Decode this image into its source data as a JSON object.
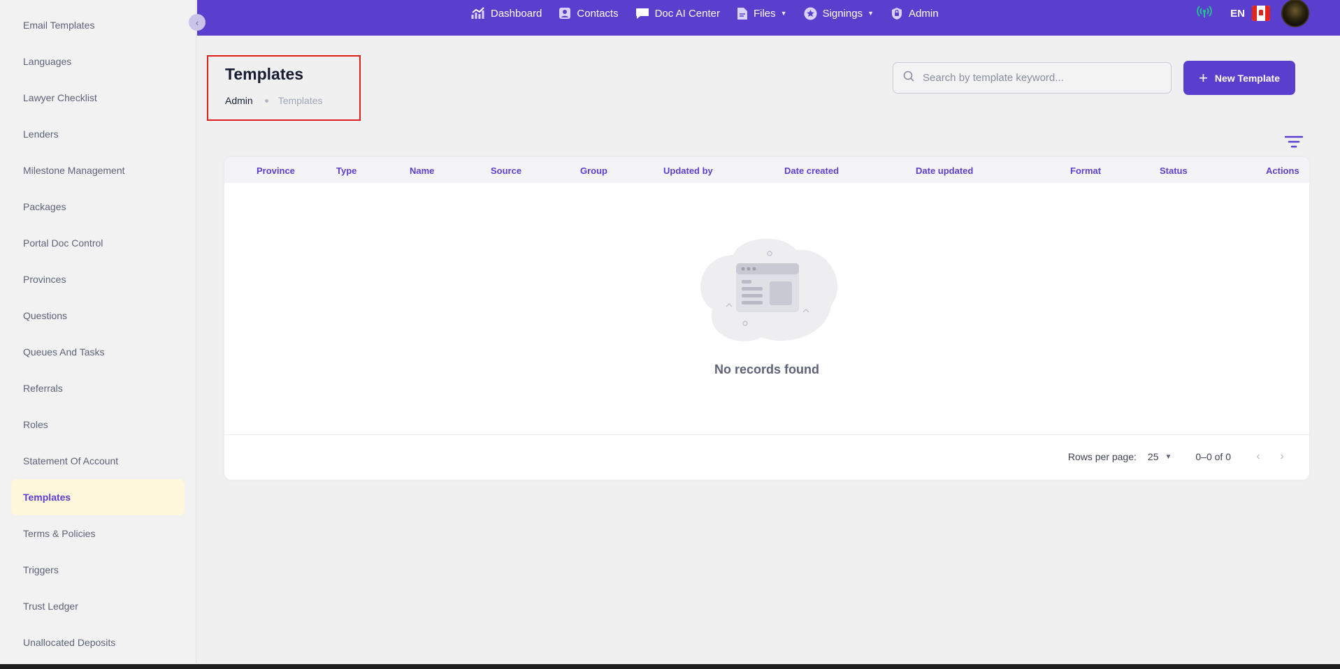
{
  "sidebar": {
    "items": [
      {
        "label": "Email Templates"
      },
      {
        "label": "Languages"
      },
      {
        "label": "Lawyer Checklist"
      },
      {
        "label": "Lenders"
      },
      {
        "label": "Milestone Management"
      },
      {
        "label": "Packages"
      },
      {
        "label": "Portal Doc Control"
      },
      {
        "label": "Provinces"
      },
      {
        "label": "Questions"
      },
      {
        "label": "Queues And Tasks"
      },
      {
        "label": "Referrals"
      },
      {
        "label": "Roles"
      },
      {
        "label": "Statement Of Account"
      },
      {
        "label": "Templates",
        "active": true
      },
      {
        "label": "Terms & Policies"
      },
      {
        "label": "Triggers"
      },
      {
        "label": "Trust Ledger"
      },
      {
        "label": "Unallocated Deposits"
      }
    ]
  },
  "topnav": {
    "items": [
      {
        "label": "Dashboard",
        "icon": "chart-line-icon"
      },
      {
        "label": "Contacts",
        "icon": "contact-card-icon"
      },
      {
        "label": "Doc AI Center",
        "icon": "message-icon"
      },
      {
        "label": "Files",
        "icon": "file-icon",
        "dropdown": true
      },
      {
        "label": "Signings",
        "icon": "star-badge-icon",
        "dropdown": true
      },
      {
        "label": "Admin",
        "icon": "lock-icon"
      }
    ],
    "language": "EN"
  },
  "page": {
    "title": "Templates",
    "breadcrumb": [
      "Admin",
      "Templates"
    ]
  },
  "search": {
    "placeholder": "Search by template keyword..."
  },
  "actions": {
    "new_template": "New Template"
  },
  "table": {
    "columns": [
      "Province",
      "Type",
      "Name",
      "Source",
      "Group",
      "Updated by",
      "Date created",
      "Date updated",
      "Format",
      "Status",
      "Actions"
    ],
    "empty_message": "No records found"
  },
  "pagination": {
    "rows_per_page_label": "Rows per page:",
    "rows_per_page": "25",
    "range": "0–0 of 0"
  },
  "colors": {
    "brand": "#5a3fcf",
    "active_bg": "#fff7dc",
    "status_green": "#1ec98b",
    "highlight_border": "#e01e1e"
  }
}
